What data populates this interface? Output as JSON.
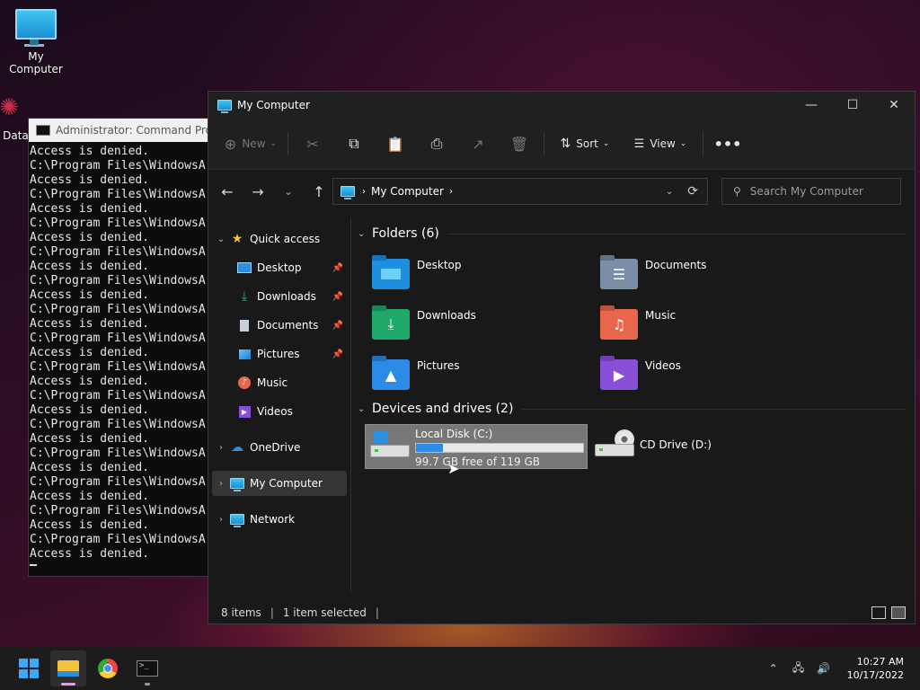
{
  "desktop": {
    "icons": [
      {
        "label": "My Computer"
      },
      {
        "label": "DataV"
      }
    ]
  },
  "cmd": {
    "title": "Administrator: Command Prompt",
    "lines": [
      "Access is denied.",
      "C:\\Program Files\\WindowsA",
      "Access is denied.",
      "C:\\Program Files\\WindowsA",
      "Access is denied.",
      "C:\\Program Files\\WindowsA",
      "Access is denied.",
      "C:\\Program Files\\WindowsA",
      "Access is denied.",
      "C:\\Program Files\\WindowsA",
      "Access is denied.",
      "C:\\Program Files\\WindowsA",
      "Access is denied.",
      "C:\\Program Files\\WindowsA",
      "Access is denied.",
      "C:\\Program Files\\WindowsA",
      "Access is denied.",
      "C:\\Program Files\\WindowsA",
      "Access is denied.",
      "C:\\Program Files\\WindowsA",
      "Access is denied.",
      "C:\\Program Files\\WindowsA",
      "Access is denied.",
      "C:\\Program Files\\WindowsA",
      "Access is denied.",
      "C:\\Program Files\\WindowsA",
      "Access is denied.",
      "C:\\Program Files\\WindowsA",
      "Access is denied."
    ]
  },
  "explorer": {
    "title": "My Computer",
    "toolbar": {
      "new_label": "New",
      "sort_label": "Sort",
      "view_label": "View"
    },
    "address": {
      "crumb": "My Computer"
    },
    "search": {
      "placeholder": "Search My Computer"
    },
    "sidebar": {
      "quick_access": "Quick access",
      "items": [
        "Desktop",
        "Downloads",
        "Documents",
        "Pictures",
        "Music",
        "Videos"
      ],
      "onedrive": "OneDrive",
      "my_computer": "My Computer",
      "network": "Network"
    },
    "folders_header": "Folders (6)",
    "folders": [
      {
        "name": "Desktop",
        "color": "#1e8fe0"
      },
      {
        "name": "Documents",
        "color": "#7a8ea8"
      },
      {
        "name": "Downloads",
        "color": "#1fa86a"
      },
      {
        "name": "Music",
        "color": "#e8664b"
      },
      {
        "name": "Pictures",
        "color": "#2b8be6"
      },
      {
        "name": "Videos",
        "color": "#8a4fd8"
      }
    ],
    "drives_header": "Devices and drives (2)",
    "drive_c": {
      "name": "Local Disk (C:)",
      "free_text": "99.7 GB free of 119 GB",
      "used_fraction": 0.162
    },
    "drive_d": {
      "name": "CD Drive (D:)"
    },
    "status": {
      "items": "8 items",
      "selected": "1 item selected"
    }
  },
  "taskbar": {
    "time": "10:27 AM",
    "date": "10/17/2022"
  }
}
